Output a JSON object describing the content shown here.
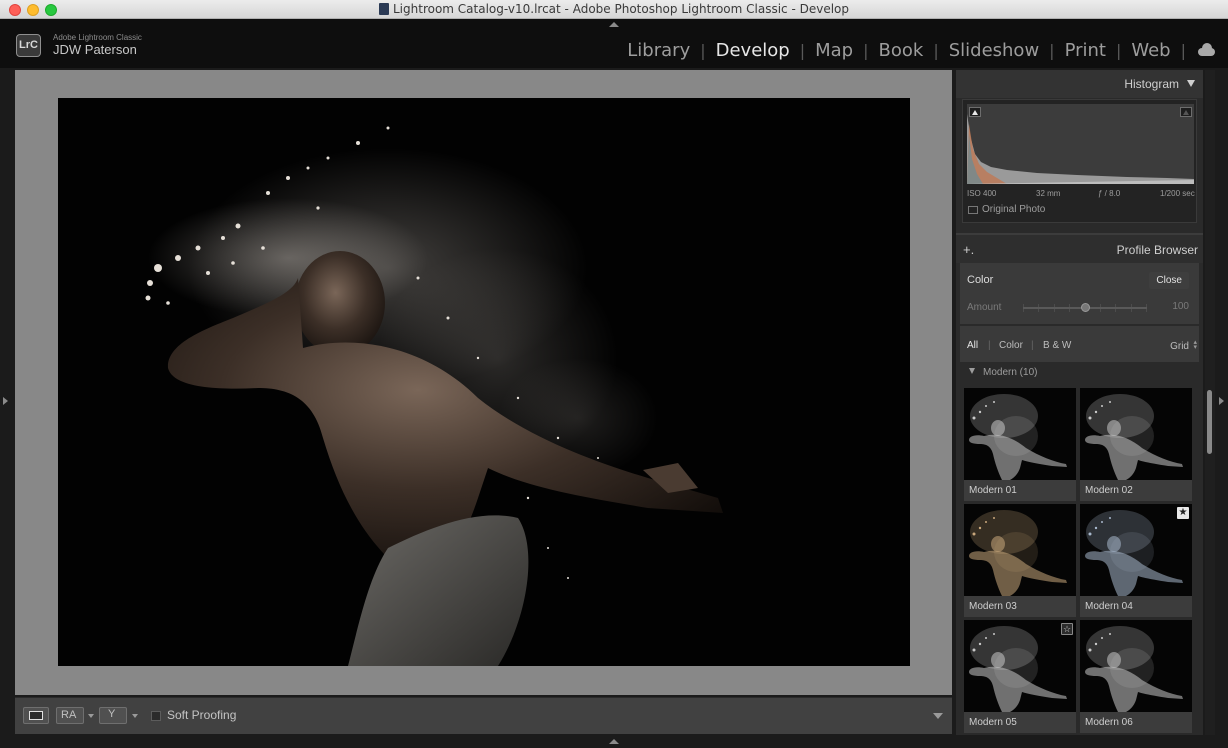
{
  "window": {
    "title": "Lightroom Catalog-v10.lrcat - Adobe Photoshop Lightroom Classic - Develop"
  },
  "identity": {
    "badge": "LrC",
    "app_name": "Adobe Lightroom Classic",
    "user_name": "JDW Paterson"
  },
  "modules": [
    {
      "label": "Library",
      "active": false
    },
    {
      "label": "Develop",
      "active": true
    },
    {
      "label": "Map",
      "active": false
    },
    {
      "label": "Book",
      "active": false
    },
    {
      "label": "Slideshow",
      "active": false
    },
    {
      "label": "Print",
      "active": false
    },
    {
      "label": "Web",
      "active": false
    }
  ],
  "toolbar": {
    "view_before_after_label": "RA",
    "soft_proofing_label": "Soft Proofing"
  },
  "histogram": {
    "title": "Histogram",
    "iso": "ISO 400",
    "focal_length": "32 mm",
    "aperture": "ƒ / 8.0",
    "shutter": "1/200 sec",
    "original_photo_label": "Original Photo"
  },
  "profile_browser": {
    "plus": "+.",
    "title": "Profile Browser",
    "current_profile": "Color",
    "close_label": "Close",
    "amount_label": "Amount",
    "amount_value": "100",
    "amount_fraction": 0.5,
    "filters": {
      "all": "All",
      "color": "Color",
      "bw": "B & W",
      "view_mode": "Grid"
    },
    "group": {
      "name": "Modern (10)"
    },
    "profiles": [
      {
        "label": "Modern 01",
        "tone": "neutral",
        "favorite": "none"
      },
      {
        "label": "Modern 02",
        "tone": "neutral",
        "favorite": "none"
      },
      {
        "label": "Modern 03",
        "tone": "warm",
        "favorite": "none"
      },
      {
        "label": "Modern 04",
        "tone": "cool",
        "favorite": "filled"
      },
      {
        "label": "Modern 05",
        "tone": "neutral",
        "favorite": "outline"
      },
      {
        "label": "Modern 06",
        "tone": "neutral",
        "favorite": "none"
      }
    ]
  },
  "colors": {
    "accent_active": "#e6e6e6",
    "panel_bg": "#2a2a2a",
    "workarea_bg": "#888888"
  }
}
